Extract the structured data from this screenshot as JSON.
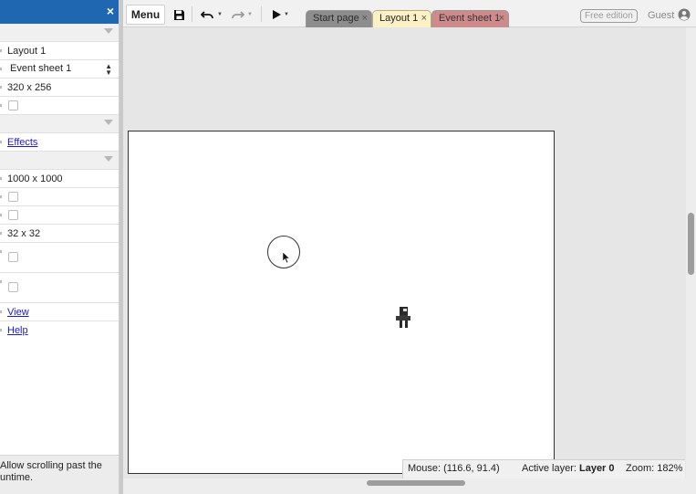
{
  "panel": {
    "close_glyph": "×",
    "rows": [
      {
        "kind": "group"
      },
      {
        "kind": "text",
        "value": "Layout 1"
      },
      {
        "kind": "select",
        "value": "Event sheet 1"
      },
      {
        "kind": "text",
        "value": "320 x 256"
      },
      {
        "kind": "checkbox"
      },
      {
        "kind": "group"
      },
      {
        "kind": "link",
        "value": "Effects"
      },
      {
        "kind": "group"
      },
      {
        "kind": "text",
        "value": "1000 x 1000"
      },
      {
        "kind": "checkbox"
      },
      {
        "kind": "checkbox"
      },
      {
        "kind": "text",
        "value": "32 x 32"
      },
      {
        "kind": "checkbox"
      },
      {
        "kind": "checkbox"
      },
      {
        "kind": "link",
        "value": "View"
      },
      {
        "kind": "link",
        "value": "Help"
      }
    ],
    "description_line1": "Allow scrolling past the",
    "description_line2": "untime."
  },
  "toolbar": {
    "menu_label": "Menu",
    "icons": [
      "save-icon",
      "undo-icon",
      "redo-icon",
      "play-icon"
    ]
  },
  "tabs": [
    {
      "label": "Start page",
      "close": "×"
    },
    {
      "label": "Layout 1",
      "close": "×"
    },
    {
      "label": "Event sheet 1",
      "close": "×"
    }
  ],
  "account": {
    "edition": "Free edition",
    "user": "Guest"
  },
  "status": {
    "mouse": "Mouse: (116.6, 91.4)",
    "active_layer_label": "Active layer:",
    "active_layer_value": "Layer 0",
    "zoom": "Zoom: 182%"
  },
  "colors": {
    "panel_header": "#1f67b0",
    "link": "#1a1ad8",
    "tab_active": "#fbf1c4",
    "tab_event": "#cf8a8c"
  }
}
